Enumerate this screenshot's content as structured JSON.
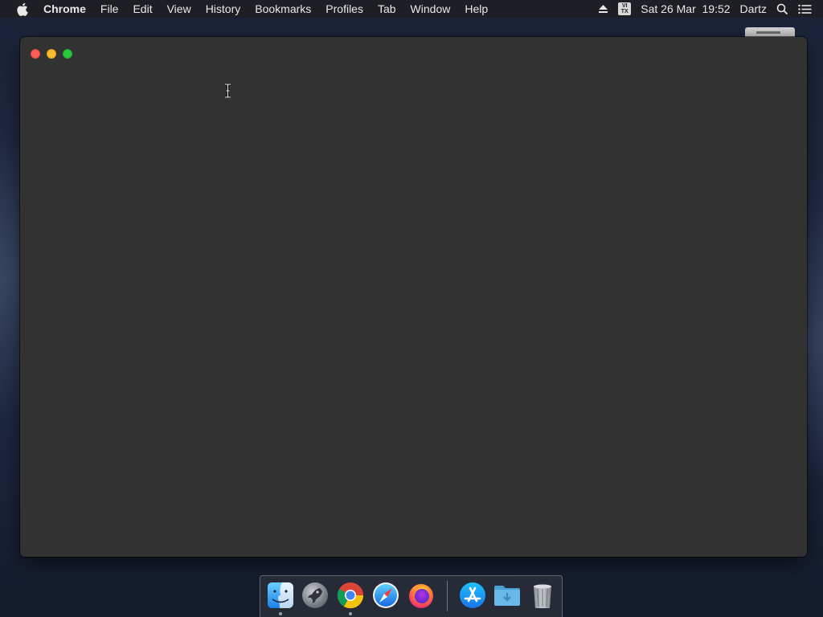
{
  "menubar": {
    "apple_icon": "apple-icon",
    "app_name": "Chrome",
    "menus": [
      "File",
      "Edit",
      "View",
      "History",
      "Bookmarks",
      "Profiles",
      "Tab",
      "Window",
      "Help"
    ],
    "status": {
      "eject_icon": "eject-icon",
      "input_method_top": "VI",
      "input_method_bottom": "TX",
      "datetime": "Sat 26 Mar  19:52",
      "user": "Dartz",
      "search_icon": "spotlight-search-icon",
      "control_icon": "notification-center-icon"
    }
  },
  "window": {
    "background": "#323232",
    "controls": [
      "close",
      "minimize",
      "maximize"
    ]
  },
  "dock": {
    "items": [
      {
        "name": "Finder",
        "icon": "finder-icon",
        "running": true
      },
      {
        "name": "Launchpad",
        "icon": "launchpad-icon",
        "running": false
      },
      {
        "name": "Google Chrome",
        "icon": "chrome-icon",
        "running": true
      },
      {
        "name": "Safari",
        "icon": "safari-icon",
        "running": false
      },
      {
        "name": "Firefox",
        "icon": "firefox-icon",
        "running": false
      },
      {
        "name": "App Store",
        "icon": "app-store-icon",
        "running": false
      },
      {
        "name": "Downloads",
        "icon": "downloads-folder-icon",
        "running": false
      },
      {
        "name": "Trash",
        "icon": "trash-icon",
        "running": false
      }
    ]
  }
}
